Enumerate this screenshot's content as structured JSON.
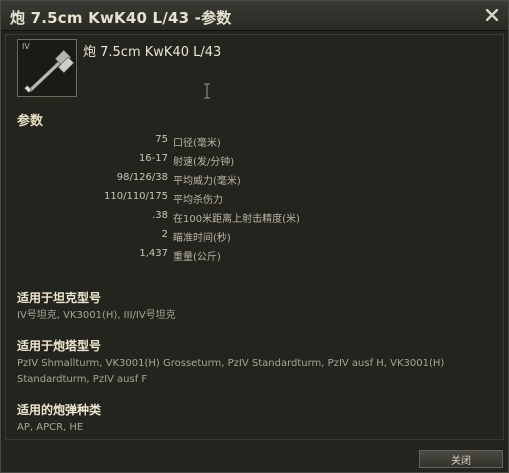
{
  "window": {
    "title": "炮 7.5cm KwK40 L/43 -参数"
  },
  "module": {
    "tier": "IV",
    "name": "炮 7.5cm KwK40 L/43"
  },
  "params": {
    "heading": "参数",
    "rows": [
      {
        "value": "75",
        "label": "口径(毫米)"
      },
      {
        "value": "16-17",
        "label": "射速(发/分钟)"
      },
      {
        "value": "98/126/38",
        "label": "平均威力(毫米)"
      },
      {
        "value": "110/110/175",
        "label": "平均杀伤力"
      },
      {
        "value": ".38",
        "label": "在100米距离上射击精度(米)"
      },
      {
        "value": "2",
        "label": "瞄准时间(秒)"
      },
      {
        "value": "1,437",
        "label": "重量(公斤)"
      }
    ]
  },
  "sections": {
    "tanks": {
      "title": "适用于坦克型号",
      "body": "IV号坦克, VK3001(H), III/IV号坦克"
    },
    "turrets": {
      "title": "适用于炮塔型号",
      "body": "PzIV Shmallturm, VK3001(H) Grosseturm, PzIV Standardturm, PzIV ausf H, VK3001(H) Standardturm, PzIV ausf F"
    },
    "ammo": {
      "title": "适用的炮弹种类",
      "body": "AP, APCR, HE"
    }
  },
  "footer": {
    "close_label": "关闭"
  }
}
